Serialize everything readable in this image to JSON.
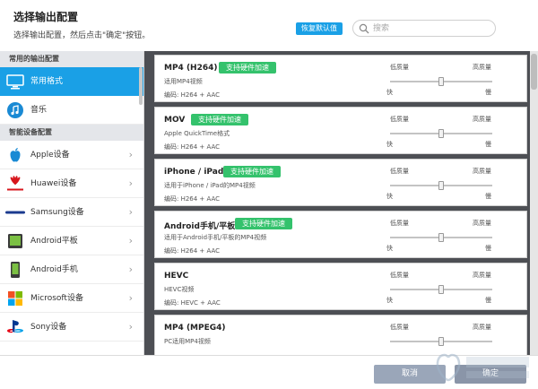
{
  "header": {
    "title": "选择输出配置",
    "subtitle": "选择输出配置，然后点击\"确定\"按钮。",
    "reset_label": "恢复默认值",
    "search_placeholder": "搜索"
  },
  "sidebar": {
    "sections": [
      {
        "title": "常用的输出配置",
        "items": [
          {
            "label": "常用格式",
            "icon": "monitor-icon",
            "active": true
          },
          {
            "label": "音乐",
            "icon": "music-note-icon"
          }
        ]
      },
      {
        "title": "智能设备配置",
        "items": [
          {
            "label": "Apple设备",
            "icon": "apple-logo-icon"
          },
          {
            "label": "Huawei设备",
            "icon": "huawei-logo-icon"
          },
          {
            "label": "Samsung设备",
            "icon": "samsung-logo-icon"
          },
          {
            "label": "Android平板",
            "icon": "tablet-icon"
          },
          {
            "label": "Android手机",
            "icon": "phone-icon"
          },
          {
            "label": "Microsoft设备",
            "icon": "windows-logo-icon"
          },
          {
            "label": "Sony设备",
            "icon": "playstation-logo-icon"
          }
        ]
      }
    ]
  },
  "presets": [
    {
      "name": "MP4 (H264)",
      "hw": "支持硬件加速",
      "desc": "适用MP4视频",
      "codec": "编码:    H264 + AAC"
    },
    {
      "name": "MOV",
      "hw": "支持硬件加速",
      "desc": "Apple QuickTime格式",
      "codec": "编码:    H264 + AAC"
    },
    {
      "name": "iPhone / iPad",
      "hw": "支持硬件加速",
      "desc": "适用于iPhone / iPad的MP4视频",
      "codec": "编码:    H264 + AAC"
    },
    {
      "name": "Android手机/平板",
      "hw": "支持硬件加速",
      "desc": "适用于Android手机/平板的MP4视频",
      "codec": "编码:    H264 + AAC"
    },
    {
      "name": "HEVC",
      "hw": "",
      "desc": "HEVC视频",
      "codec": "编码:    HEVC + AAC"
    },
    {
      "name": "MP4 (MPEG4)",
      "hw": "",
      "desc": "PC适用MP4视频",
      "codec": ""
    }
  ],
  "quality": {
    "low": "低质量",
    "high": "高质量",
    "fast": "快",
    "slow": "慢",
    "level": 0.5
  },
  "footer": {
    "cancel_label": "取消",
    "ok_label": "确定"
  },
  "colors": {
    "accent": "#1aa0e6",
    "badge": "#34c26c",
    "panel": "#4d4f54"
  }
}
